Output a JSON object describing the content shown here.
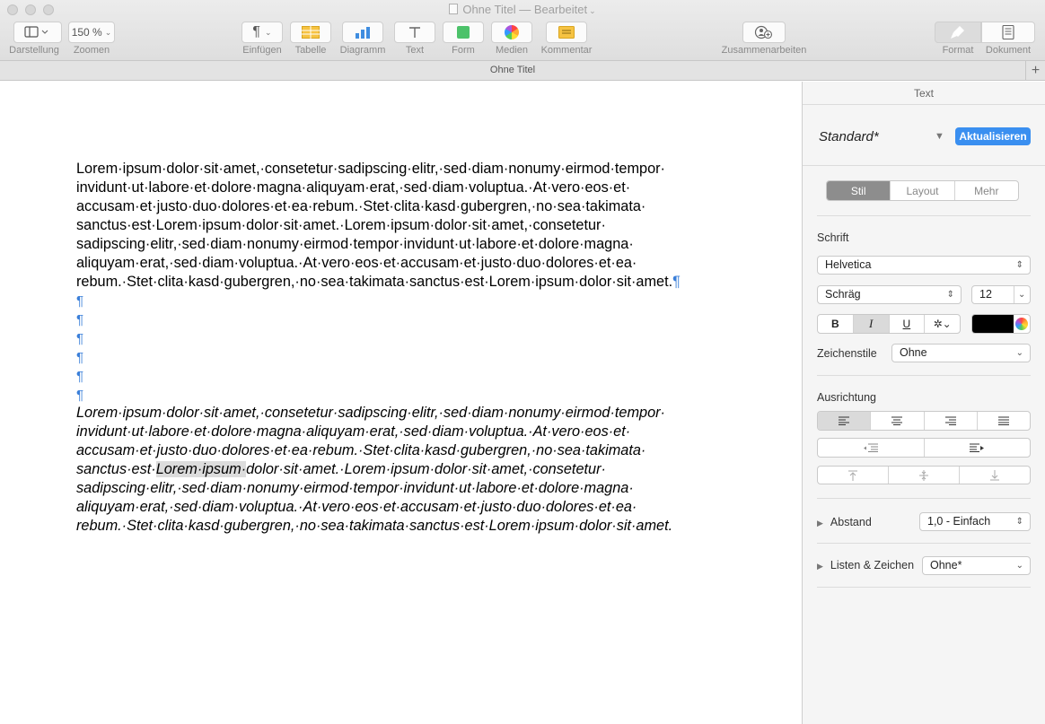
{
  "window": {
    "title": "Ohne Titel",
    "status": "— Bearbeitet"
  },
  "toolbar": {
    "darstellung": {
      "label": "Darstellung",
      "icon": "sidebar-view-icon"
    },
    "zoom": {
      "value": "150 %",
      "label": "Zoomen"
    },
    "einfuegen": {
      "label": "Einfügen",
      "icon": "pilcrow-icon"
    },
    "tabelle": {
      "label": "Tabelle",
      "icon": "table-icon"
    },
    "diagramm": {
      "label": "Diagramm",
      "icon": "chart-icon"
    },
    "text": {
      "label": "Text",
      "icon": "text-icon"
    },
    "form": {
      "label": "Form",
      "icon": "shape-icon"
    },
    "medien": {
      "label": "Medien",
      "icon": "media-icon"
    },
    "kommentar": {
      "label": "Kommentar",
      "icon": "comment-icon"
    },
    "zusammenarbeiten": {
      "label": "Zusammenarbeiten",
      "icon": "collaborate-icon"
    },
    "format": {
      "label": "Format",
      "icon": "paintbrush-icon"
    },
    "dokument": {
      "label": "Dokument",
      "icon": "document-icon"
    }
  },
  "tabbar": {
    "title": "Ohne Titel",
    "plus": "+"
  },
  "document": {
    "paragraph1": "Lorem·ipsum·dolor·sit·amet,·consetetur·sadipscing·elitr,·sed·diam·nonumy·eirmod·tempor· invidunt·ut·labore·et·dolore·magna·aliquyam·erat,·sed·diam·voluptua.·At·vero·eos·et· accusam·et·justo·duo·dolores·et·ea·rebum.·Stet·clita·kasd·gubergren,·no·sea·takimata· sanctus·est·Lorem·ipsum·dolor·sit·amet.·Lorem·ipsum·dolor·sit·amet,·consetetur· sadipscing·elitr,·sed·diam·nonumy·eirmod·tempor·invidunt·ut·labore·et·dolore·magna· aliquyam·erat,·sed·diam·voluptua.·At·vero·eos·et·accusam·et·justo·duo·dolores·et·ea· rebum.·Stet·clita·kasd·gubergren,·no·sea·takimata·sanctus·est·Lorem·ipsum·dolor·sit·amet.",
    "pilcrow": "¶",
    "empty_marks": [
      "¶",
      "¶",
      "¶",
      "¶",
      "¶",
      "¶"
    ],
    "paragraph2_before": "Lorem·ipsum·dolor·sit·amet,·consetetur·sadipscing·elitr,·sed·diam·nonumy·eirmod·tempor· invidunt·ut·labore·et·dolore·magna·aliquyam·erat,·sed·diam·voluptua.·At·vero·eos·et· accusam·et·justo·duo·dolores·et·ea·rebum.·Stet·clita·kasd·gubergren,·no·sea·takimata· sanctus·est·",
    "paragraph2_selected": "Lorem·ipsum·",
    "paragraph2_after": "dolor·sit·amet.·Lorem·ipsum·dolor·sit·amet,·consetetur· sadipscing·elitr,·sed·diam·nonumy·eirmod·tempor·invidunt·ut·labore·et·dolore·magna· aliquyam·erat,·sed·diam·voluptua.·At·vero·eos·et·accusam·et·justo·duo·dolores·et·ea· rebum.·Stet·clita·kasd·gubergren,·no·sea·takimata·sanctus·est·Lorem·ipsum·dolor·sit·amet."
  },
  "inspector": {
    "header": "Text",
    "style_name": "Standard*",
    "update_button": "Aktualisieren",
    "tabs": [
      "Stil",
      "Layout",
      "Mehr"
    ],
    "font_section": "Schrift",
    "font_family": "Helvetica",
    "font_typeface": "Schräg",
    "font_size": "12",
    "bold": "B",
    "italic": "I",
    "underline": "U",
    "text_color": "#000000",
    "char_styles_label": "Zeichenstile",
    "char_styles_value": "Ohne",
    "alignment_section": "Ausrichtung",
    "spacing_label": "Abstand",
    "spacing_value": "1,0 - Einfach",
    "lists_label": "Listen & Zeichen",
    "lists_value": "Ohne*",
    "accent": "#3a8ff0"
  }
}
